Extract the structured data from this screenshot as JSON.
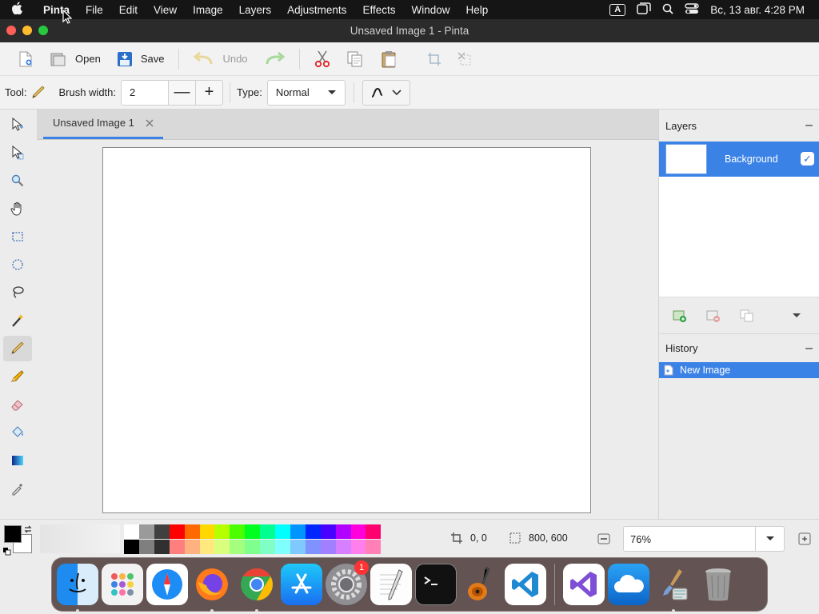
{
  "menubar": {
    "app": "Pinta",
    "items": [
      "File",
      "Edit",
      "View",
      "Image",
      "Layers",
      "Adjustments",
      "Effects",
      "Window",
      "Help"
    ],
    "input_indicator": "A",
    "datetime": "Вс, 13 авг. 4:28 PM"
  },
  "window": {
    "title": "Unsaved Image 1 - Pinta"
  },
  "toolbar": {
    "open_label": "Open",
    "save_label": "Save",
    "undo_label": "Undo"
  },
  "options": {
    "tool_label": "Tool:",
    "brush_width_label": "Brush width:",
    "brush_width_value": "2",
    "type_label": "Type:",
    "type_value": "Normal"
  },
  "document": {
    "tab_title": "Unsaved Image 1"
  },
  "layers": {
    "header": "Layers",
    "items": [
      {
        "name": "Background",
        "visible": true
      }
    ]
  },
  "history": {
    "header": "History",
    "items": [
      "New Image"
    ]
  },
  "status": {
    "cursor_position": "0, 0",
    "image_size": "800, 600",
    "zoom": "76%"
  },
  "palette": {
    "primary": "#000000",
    "secondary": "#ffffff",
    "top_row": [
      "#ffffff",
      "#9a9a9a",
      "#404040",
      "#ff0000",
      "#ff6a00",
      "#ffd800",
      "#b6ff00",
      "#4cff00",
      "#00ff21",
      "#00ff90",
      "#00ffff",
      "#0094ff",
      "#0026ff",
      "#4800ff",
      "#b200ff",
      "#ff00dc",
      "#ff006e"
    ],
    "bottom_row": [
      "#000000",
      "#7f7f7f",
      "#303030",
      "#ff7f7f",
      "#ffb27f",
      "#ffe97f",
      "#daff7f",
      "#a5ff7f",
      "#7fff8e",
      "#7fffc5",
      "#7fffff",
      "#7fc9ff",
      "#7f92ff",
      "#a17fff",
      "#d67fff",
      "#ff7fed",
      "#ff7fb6"
    ]
  },
  "dock": {
    "apps": [
      "finder-icon",
      "launchpad-icon",
      "safari-icon",
      "firefox-icon",
      "chrome-icon",
      "app-store-icon",
      "system-settings-icon",
      "textedit-icon",
      "terminal-icon",
      "garageband-icon",
      "vscode-icon",
      "visual-studio-icon",
      "onedrive-icon",
      "pinta-icon",
      "trash-icon"
    ],
    "settings_badge": "1"
  },
  "colors": {
    "accent": "#3b82e6"
  }
}
